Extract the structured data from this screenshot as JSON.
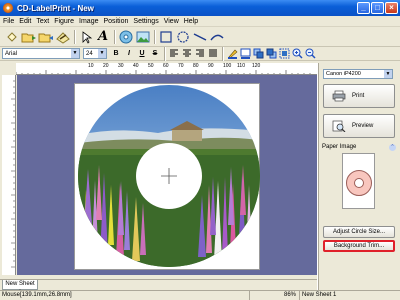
{
  "window": {
    "title": "CD-LabelPrint - New"
  },
  "menu": [
    "File",
    "Edit",
    "Text",
    "Figure",
    "Image",
    "Position",
    "Settings",
    "View",
    "Help"
  ],
  "format": {
    "font": "Arial",
    "size": "24",
    "bold": "B",
    "italic": "I",
    "underline": "U",
    "strike": "S"
  },
  "ruler": {
    "hticks": [
      "10",
      "20",
      "30",
      "40",
      "50",
      "60",
      "70",
      "80",
      "90",
      "100",
      "110",
      "120"
    ]
  },
  "tabs": {
    "active": "New Sheet 1"
  },
  "status": {
    "mouse": "Mouse[139.1mm,26.8mm]",
    "zoom": "86%",
    "sheet": "New Sheet 1"
  },
  "panel": {
    "printer": "Canon iP4200",
    "print_label": "Print",
    "preview_label": "Preview",
    "paper_image_label": "Paper Image",
    "adjust_label": "Adjust Circle Size...",
    "trim_label": "Background Trim..."
  },
  "colors": {
    "title_bar": "#0A5FD8",
    "canvas_bg": "#656A9C",
    "highlight": "#E0202A"
  }
}
